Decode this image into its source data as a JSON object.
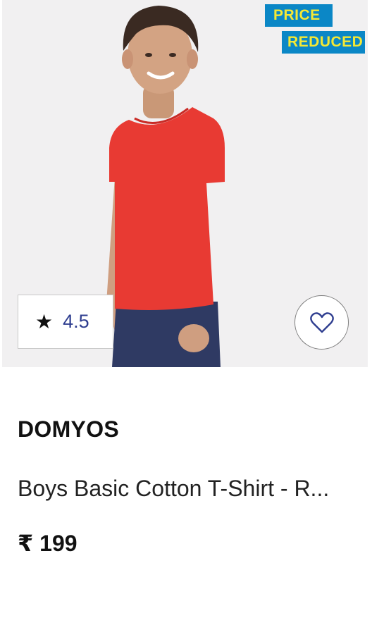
{
  "product": {
    "badge": {
      "line1": "PRICE",
      "line2": "REDUCED"
    },
    "rating": {
      "star_icon": "star-icon",
      "value": "4.5"
    },
    "wishlist_icon": "heart-icon",
    "brand": "DOMYOS",
    "title": "Boys Basic Cotton T-Shirt - R...",
    "price": "₹ 199"
  },
  "colors": {
    "image_background": "#f1f0f1",
    "badge_background": "#0b87c6",
    "badge_text": "#f5e834",
    "rating_value": "#2e3d8f",
    "shirt": "#e83a33",
    "shorts": "#2f3a63"
  }
}
